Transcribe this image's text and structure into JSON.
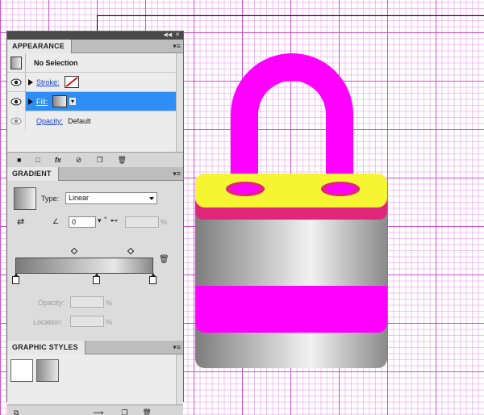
{
  "appearance": {
    "tab": "APPEARANCE",
    "selection": "No Selection",
    "rows": [
      {
        "label": "Stroke:",
        "kind": "stroke"
      },
      {
        "label": "Fill:",
        "kind": "fill"
      },
      {
        "label": "Opacity:",
        "value": "Default"
      }
    ]
  },
  "gradient": {
    "tab": "GRADIENT",
    "type_label": "Type:",
    "type_value": "Linear",
    "angle_value": "0",
    "angle_unit": "°",
    "aspect_unit": "%",
    "opacity_label": "Opacity:",
    "opacity_unit": "%",
    "location_label": "Location:",
    "location_unit": "%"
  },
  "graphic_styles": {
    "tab": "GRAPHIC STYLES"
  },
  "colors": {
    "magenta": "#ff00ff",
    "yellow": "#f5f532",
    "pink_band": "#e0267a",
    "selection_blue": "#2f8ef5"
  }
}
